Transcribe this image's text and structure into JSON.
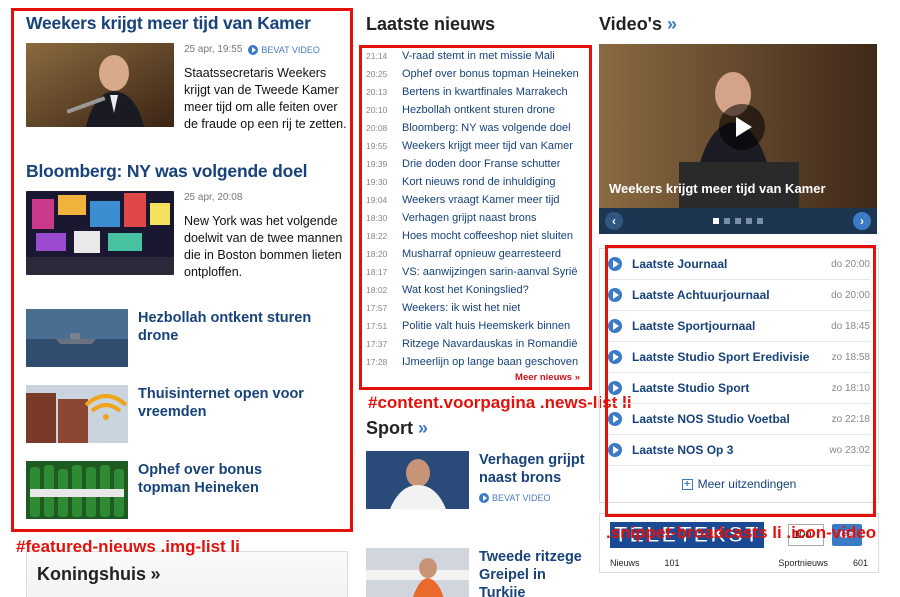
{
  "featured": [
    {
      "title": "Weekers krijgt meer tijd van Kamer",
      "date": "25 apr, 19:55",
      "badge": "BEVAT VIDEO",
      "text": "Staatssecretaris Weekers krijgt van de Tweede Kamer meer tijd om alle feiten over de fraude op een rij te zetten."
    },
    {
      "title": "Bloomberg: NY was volgende doel",
      "date": "25 apr, 20:08",
      "text": "New York was het volgende doelwit van de twee mannen die in Boston bommen lieten ontploffen."
    }
  ],
  "img_list": [
    {
      "title": "Hezbollah ontkent sturen drone"
    },
    {
      "title": "Thuisinternet open voor vreemden"
    },
    {
      "title": "Ophef over bonus topman Heineken"
    }
  ],
  "koningshuis": {
    "label": "Koningshuis",
    "arrow": "»"
  },
  "latest": {
    "heading": "Laatste nieuws",
    "items": [
      {
        "time": "21:14",
        "title": "V-raad stemt in met missie Mali"
      },
      {
        "time": "20:25",
        "title": "Ophef over bonus topman Heineken"
      },
      {
        "time": "20:13",
        "title": "Bertens in kwartfinales Marrakech"
      },
      {
        "time": "20:10",
        "title": "Hezbollah ontkent sturen drone"
      },
      {
        "time": "20:08",
        "title": "Bloomberg: NY was volgende doel"
      },
      {
        "time": "19:55",
        "title": "Weekers krijgt meer tijd van Kamer"
      },
      {
        "time": "19:39",
        "title": "Drie doden door Franse schutter"
      },
      {
        "time": "19:30",
        "title": "Kort nieuws rond de inhuldiging"
      },
      {
        "time": "19:04",
        "title": "Weekers vraagt Kamer meer tijd"
      },
      {
        "time": "18:30",
        "title": "Verhagen grijpt naast brons"
      },
      {
        "time": "18:22",
        "title": "Hoes mocht coffeeshop niet sluiten"
      },
      {
        "time": "18:20",
        "title": "Musharraf opnieuw gearresteerd"
      },
      {
        "time": "18:17",
        "title": "VS: aanwijzingen sarin-aanval Syrië"
      },
      {
        "time": "18:02",
        "title": "Wat kost het Koningslied?"
      },
      {
        "time": "17:57",
        "title": "Weekers: ik wist het niet"
      },
      {
        "time": "17:51",
        "title": "Politie valt huis Heemskerk binnen"
      },
      {
        "time": "17:37",
        "title": "Ritzege Navardauskas in Romandië"
      },
      {
        "time": "17:28",
        "title": "IJmeerlijn op lange baan geschoven"
      }
    ],
    "more": "Meer nieuws »"
  },
  "sport": {
    "heading": "Sport",
    "arrow": "»",
    "items": [
      {
        "title": "Verhagen grijpt naast brons",
        "badge": "BEVAT VIDEO"
      },
      {
        "title": "Tweede ritzege Greipel in Turkije"
      }
    ]
  },
  "videos": {
    "heading": "Video's",
    "arrow": "»",
    "caption": "Weekers krijgt meer tijd van Kamer",
    "prev": "‹",
    "next": "›"
  },
  "broadcasts": {
    "items": [
      {
        "title": "Laatste Journaal",
        "time": "do 20:00"
      },
      {
        "title": "Laatste Achtuurjournaal",
        "time": "do 20:00"
      },
      {
        "title": "Laatste Sportjournaal",
        "time": "do 18:45"
      },
      {
        "title": "Laatste Studio Sport Eredivisie",
        "time": "zo 18:58"
      },
      {
        "title": "Laatste Studio Sport",
        "time": "zo 18:10"
      },
      {
        "title": "Laatste NOS Studio Voetbal",
        "time": "zo 22:18"
      },
      {
        "title": "Laatste NOS Op 3",
        "time": "wo 23:02"
      }
    ],
    "more": "Meer uitzendingen"
  },
  "teletekst": {
    "logo": "TELETEKST",
    "page_value": "100",
    "go": "Ga",
    "row": [
      {
        "label": "Nieuws",
        "num": "101"
      },
      {
        "label": "Sportnieuws",
        "num": "601"
      }
    ]
  },
  "annotations": {
    "featured": "#featured-nieuws .img-list li",
    "news": "#content.voorpagina .news-list li",
    "broadcasts": ".snippet-broadcasts li .icon-video"
  },
  "colors": {
    "link": "#17427a",
    "accent": "#3b7ac5",
    "annotation": "#e3110c"
  }
}
